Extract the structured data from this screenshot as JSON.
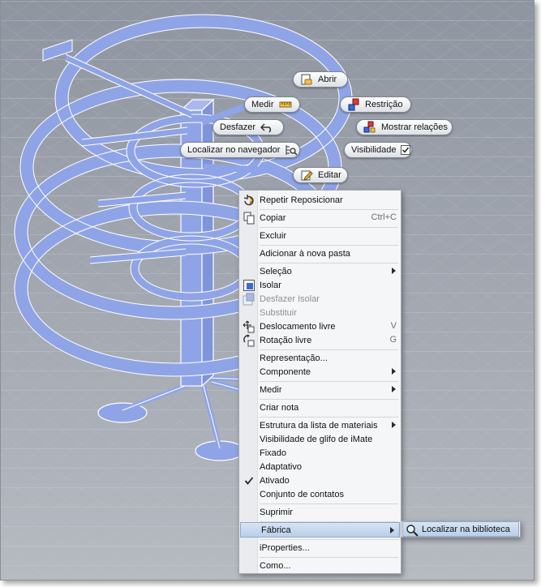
{
  "colors": {
    "viewport_top": "#8f95a0",
    "viewport_bottom": "#b6bac1",
    "model_fill": "#8fa4e6",
    "model_edge": "#ffffff",
    "menu_bg": "#f5f6f8",
    "menu_highlight": "#c7d9ef"
  },
  "marking_menu": {
    "open": {
      "label": "Abrir",
      "icon": "open-icon"
    },
    "measure": {
      "label": "Medir",
      "icon": "ruler-icon"
    },
    "constraint": {
      "label": "Restrição",
      "icon": "constraint-icon"
    },
    "undo": {
      "label": "Desfazer",
      "icon": "undo-arrow-icon"
    },
    "show_relations": {
      "label": "Mostrar relações",
      "icon": "relations-icon"
    },
    "find_browser": {
      "label": "Localizar no navegador",
      "icon": "browser-find-icon"
    },
    "visibility": {
      "label": "Visibilidade",
      "checked": true,
      "icon": "checkbox-checked-icon"
    },
    "edit": {
      "label": "Editar",
      "icon": "pencil-edit-icon"
    }
  },
  "context_menu": {
    "items": [
      {
        "label": "Repetir Reposicionar",
        "icon": "repeat-icon",
        "shortcut": "",
        "submenu": false,
        "disabled": false
      },
      {
        "label": "Copiar",
        "icon": "copy-icon",
        "shortcut": "Ctrl+C",
        "submenu": false,
        "disabled": false
      },
      {
        "label": "Excluir",
        "icon": "",
        "shortcut": "",
        "submenu": false,
        "disabled": false
      },
      {
        "label": "Adicionar à nova pasta",
        "icon": "",
        "shortcut": "",
        "submenu": false,
        "disabled": false
      },
      {
        "label": "Seleção",
        "icon": "",
        "shortcut": "",
        "submenu": true,
        "disabled": false
      },
      {
        "label": "Isolar",
        "icon": "isolate-icon",
        "shortcut": "",
        "submenu": false,
        "disabled": false
      },
      {
        "label": "Desfazer Isolar",
        "icon": "undo-isolate-icon",
        "shortcut": "",
        "submenu": false,
        "disabled": true
      },
      {
        "label": "Substituir",
        "icon": "",
        "shortcut": "",
        "submenu": false,
        "disabled": true
      },
      {
        "label": "Deslocamento livre",
        "icon": "free-move-icon",
        "shortcut": "V",
        "submenu": false,
        "disabled": false
      },
      {
        "label": "Rotação livre",
        "icon": "free-rotate-icon",
        "shortcut": "G",
        "submenu": false,
        "disabled": false
      },
      {
        "label": "Representação...",
        "icon": "",
        "shortcut": "",
        "submenu": false,
        "disabled": false
      },
      {
        "label": "Componente",
        "icon": "",
        "shortcut": "",
        "submenu": true,
        "disabled": false
      },
      {
        "label": "Medir",
        "icon": "",
        "shortcut": "",
        "submenu": true,
        "disabled": false
      },
      {
        "label": "Criar nota",
        "icon": "",
        "shortcut": "",
        "submenu": false,
        "disabled": false
      },
      {
        "label": "Estrutura da lista de materiais",
        "icon": "",
        "shortcut": "",
        "submenu": true,
        "disabled": false
      },
      {
        "label": "Visibilidade de glifo de iMate",
        "icon": "",
        "shortcut": "",
        "submenu": false,
        "disabled": false
      },
      {
        "label": "Fixado",
        "icon": "",
        "shortcut": "",
        "submenu": false,
        "disabled": false
      },
      {
        "label": "Adaptativo",
        "icon": "",
        "shortcut": "",
        "submenu": false,
        "disabled": false
      },
      {
        "label": "Ativado",
        "icon": "checkmark-icon",
        "shortcut": "",
        "submenu": false,
        "disabled": false,
        "checked": true
      },
      {
        "label": "Conjunto de contatos",
        "icon": "",
        "shortcut": "",
        "submenu": false,
        "disabled": false
      },
      {
        "label": "Suprimir",
        "icon": "",
        "shortcut": "",
        "submenu": false,
        "disabled": false
      },
      {
        "label": "Fábrica",
        "icon": "",
        "shortcut": "",
        "submenu": true,
        "disabled": false,
        "highlighted": true
      },
      {
        "label": "iProperties...",
        "icon": "",
        "shortcut": "",
        "submenu": false,
        "disabled": false
      },
      {
        "label": "Como...",
        "icon": "",
        "shortcut": "",
        "submenu": false,
        "disabled": false
      }
    ]
  },
  "submenu": {
    "label": "Localizar na biblioteca",
    "icon": "magnifier-icon"
  }
}
